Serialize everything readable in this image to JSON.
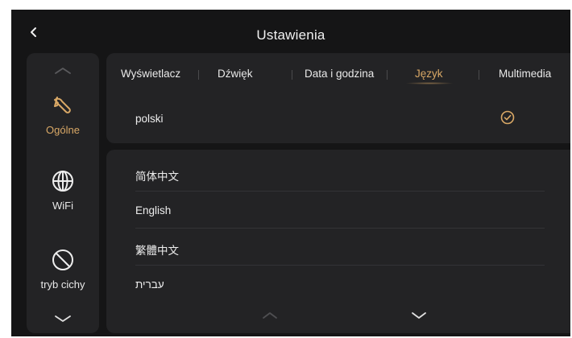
{
  "header": {
    "title": "Ustawienia",
    "back_icon": "chevron-left-icon"
  },
  "sidebar": {
    "items": [
      {
        "label": "Ogólne",
        "icon": "wrench-icon",
        "active": true
      },
      {
        "label": "WiFi",
        "icon": "globe-icon",
        "active": false
      },
      {
        "label": "tryb cichy",
        "icon": "no-sign-icon",
        "active": false
      }
    ],
    "scroll_up_icon": "chevron-up-icon",
    "scroll_down_icon": "chevron-down-icon"
  },
  "tabs": [
    {
      "label": "Wyświetlacz",
      "active": false
    },
    {
      "label": "Dźwięk",
      "active": false
    },
    {
      "label": "Data i godzina",
      "active": false
    },
    {
      "label": "Język",
      "active": true
    },
    {
      "label": "Multimedia",
      "active": false
    }
  ],
  "current_language": {
    "label": "polski",
    "selected_icon": "check-circle-icon"
  },
  "language_list": {
    "items": [
      "简体中文",
      "English",
      "繁體中文",
      "עברית"
    ],
    "scroll_up_icon": "chevron-up-icon",
    "scroll_down_icon": "chevron-down-icon"
  },
  "colors": {
    "background": "#151516",
    "panel": "#232325",
    "accent": "#d9a866",
    "text": "#ededed"
  }
}
